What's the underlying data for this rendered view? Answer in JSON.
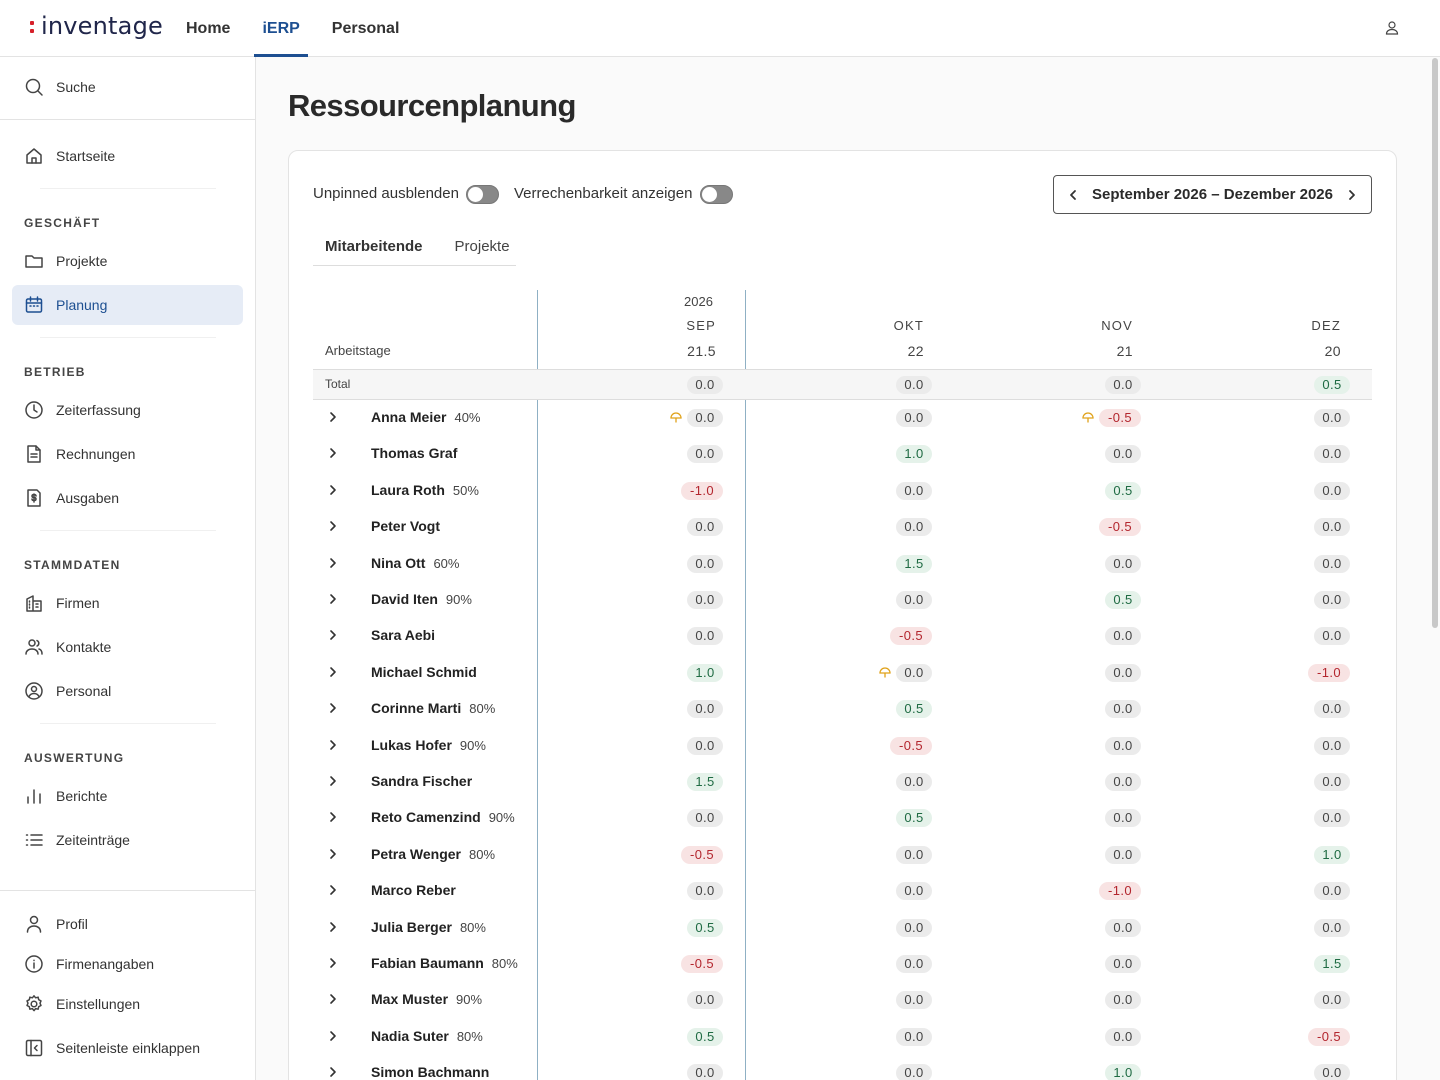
{
  "app": {
    "logo": "inventage"
  },
  "topnav": {
    "items": [
      "Home",
      "iERP",
      "Personal"
    ],
    "active": "iERP"
  },
  "sidebar": {
    "search": "Suche",
    "home": "Startseite",
    "sections": {
      "geschaeft": "GESCHÄFT",
      "betrieb": "BETRIEB",
      "stammdaten": "STAMMDATEN",
      "auswertung": "AUSWERTUNG"
    },
    "items": {
      "projekte": "Projekte",
      "planung": "Planung",
      "zeiterfassung": "Zeiterfassung",
      "rechnungen": "Rechnungen",
      "ausgaben": "Ausgaben",
      "firmen": "Firmen",
      "kontakte": "Kontakte",
      "personal": "Personal",
      "berichte": "Berichte",
      "zeiteintraege": "Zeiteinträge",
      "profil": "Profil",
      "firmenangaben": "Firmenangaben",
      "einstellungen": "Einstellungen",
      "einklappen": "Seitenleiste einklappen"
    }
  },
  "page": {
    "title": "Ressourcenplanung",
    "toggle_unpinned": "Unpinned ausblenden",
    "toggle_billing": "Verrechenbarkeit anzeigen",
    "date_range": "September 2026 – Dezember 2026",
    "tabs": [
      "Mitarbeitende",
      "Projekte"
    ],
    "active_tab": "Mitarbeitende"
  },
  "table": {
    "year": "2026",
    "months": [
      "SEP",
      "OKT",
      "NOV",
      "DEZ"
    ],
    "workdays_label": "Arbeitstage",
    "workdays": [
      "21.5",
      "22",
      "21",
      "20"
    ],
    "total_label": "Total",
    "totals": [
      "0.0",
      "0.0",
      "0.0",
      "0.5"
    ],
    "rows": [
      {
        "name": "Anna Meier",
        "pct": "40%",
        "v": [
          "0.0",
          "0.0",
          "0.0",
          "-0.5",
          "0.0"
        ],
        "cells": [
          "0.0",
          "0.0",
          "-0.5",
          "0.0"
        ],
        "warn": [
          true,
          false,
          true,
          false
        ]
      },
      {
        "name": "Thomas Graf",
        "pct": "",
        "cells": [
          "0.0",
          "1.0",
          "0.0",
          "0.0"
        ],
        "warn": [
          false,
          false,
          false,
          false
        ]
      },
      {
        "name": "Laura Roth",
        "pct": "50%",
        "cells": [
          "-1.0",
          "0.0",
          "0.5",
          "0.0"
        ],
        "warn": [
          false,
          false,
          false,
          false
        ]
      },
      {
        "name": "Peter Vogt",
        "pct": "",
        "cells": [
          "0.0",
          "0.0",
          "-0.5",
          "0.0"
        ],
        "warn": [
          false,
          false,
          false,
          false
        ]
      },
      {
        "name": "Nina Ott",
        "pct": "60%",
        "cells": [
          "0.0",
          "1.5",
          "0.0",
          "0.0"
        ],
        "warn": [
          false,
          false,
          false,
          false
        ]
      },
      {
        "name": "David Iten",
        "pct": "90%",
        "cells": [
          "0.0",
          "0.0",
          "0.5",
          "0.0"
        ],
        "warn": [
          false,
          false,
          false,
          false
        ]
      },
      {
        "name": "Sara Aebi",
        "pct": "",
        "cells": [
          "0.0",
          "-0.5",
          "0.0",
          "0.0"
        ],
        "warn": [
          false,
          false,
          false,
          false
        ]
      },
      {
        "name": "Michael Schmid",
        "pct": "",
        "cells": [
          "1.0",
          "0.0",
          "0.0",
          "-1.0"
        ],
        "warn": [
          false,
          true,
          false,
          false
        ]
      },
      {
        "name": "Corinne Marti",
        "pct": "80%",
        "cells": [
          "0.0",
          "0.5",
          "0.0",
          "0.0"
        ],
        "warn": [
          false,
          false,
          false,
          false
        ]
      },
      {
        "name": "Lukas Hofer",
        "pct": "90%",
        "cells": [
          "0.0",
          "-0.5",
          "0.0",
          "0.0"
        ],
        "warn": [
          false,
          false,
          false,
          false
        ]
      },
      {
        "name": "Sandra Fischer",
        "pct": "",
        "cells": [
          "1.5",
          "0.0",
          "0.0",
          "0.0"
        ],
        "warn": [
          false,
          false,
          false,
          false
        ]
      },
      {
        "name": "Reto Camenzind",
        "pct": "90%",
        "cells": [
          "0.0",
          "0.5",
          "0.0",
          "0.0"
        ],
        "warn": [
          false,
          false,
          false,
          false
        ]
      },
      {
        "name": "Petra Wenger",
        "pct": "80%",
        "cells": [
          "-0.5",
          "0.0",
          "0.0",
          "1.0"
        ],
        "warn": [
          false,
          false,
          false,
          false
        ]
      },
      {
        "name": "Marco Reber",
        "pct": "",
        "cells": [
          "0.0",
          "0.0",
          "-1.0",
          "0.0"
        ],
        "warn": [
          false,
          false,
          false,
          false
        ]
      },
      {
        "name": "Julia Berger",
        "pct": "80%",
        "cells": [
          "0.5",
          "0.0",
          "0.0",
          "0.0"
        ],
        "warn": [
          false,
          false,
          false,
          false
        ]
      },
      {
        "name": "Fabian Baumann",
        "pct": "80%",
        "cells": [
          "-0.5",
          "0.0",
          "0.0",
          "1.5"
        ],
        "warn": [
          false,
          false,
          false,
          false
        ]
      },
      {
        "name": "Max Muster",
        "pct": "90%",
        "cells": [
          "0.0",
          "0.0",
          "0.0",
          "0.0"
        ],
        "warn": [
          false,
          false,
          false,
          false
        ]
      },
      {
        "name": "Nadia Suter",
        "pct": "80%",
        "cells": [
          "0.5",
          "0.0",
          "0.0",
          "-0.5"
        ],
        "warn": [
          false,
          false,
          false,
          false
        ]
      },
      {
        "name": "Simon Bachmann",
        "pct": "",
        "cells": [
          "0.0",
          "0.0",
          "1.0",
          "0.0"
        ],
        "warn": [
          false,
          false,
          false,
          false
        ]
      }
    ]
  },
  "colors": {
    "accent": "#1d4f91",
    "positive": "#1f6b43",
    "negative": "#b3262e",
    "warning": "#e0a21a"
  }
}
